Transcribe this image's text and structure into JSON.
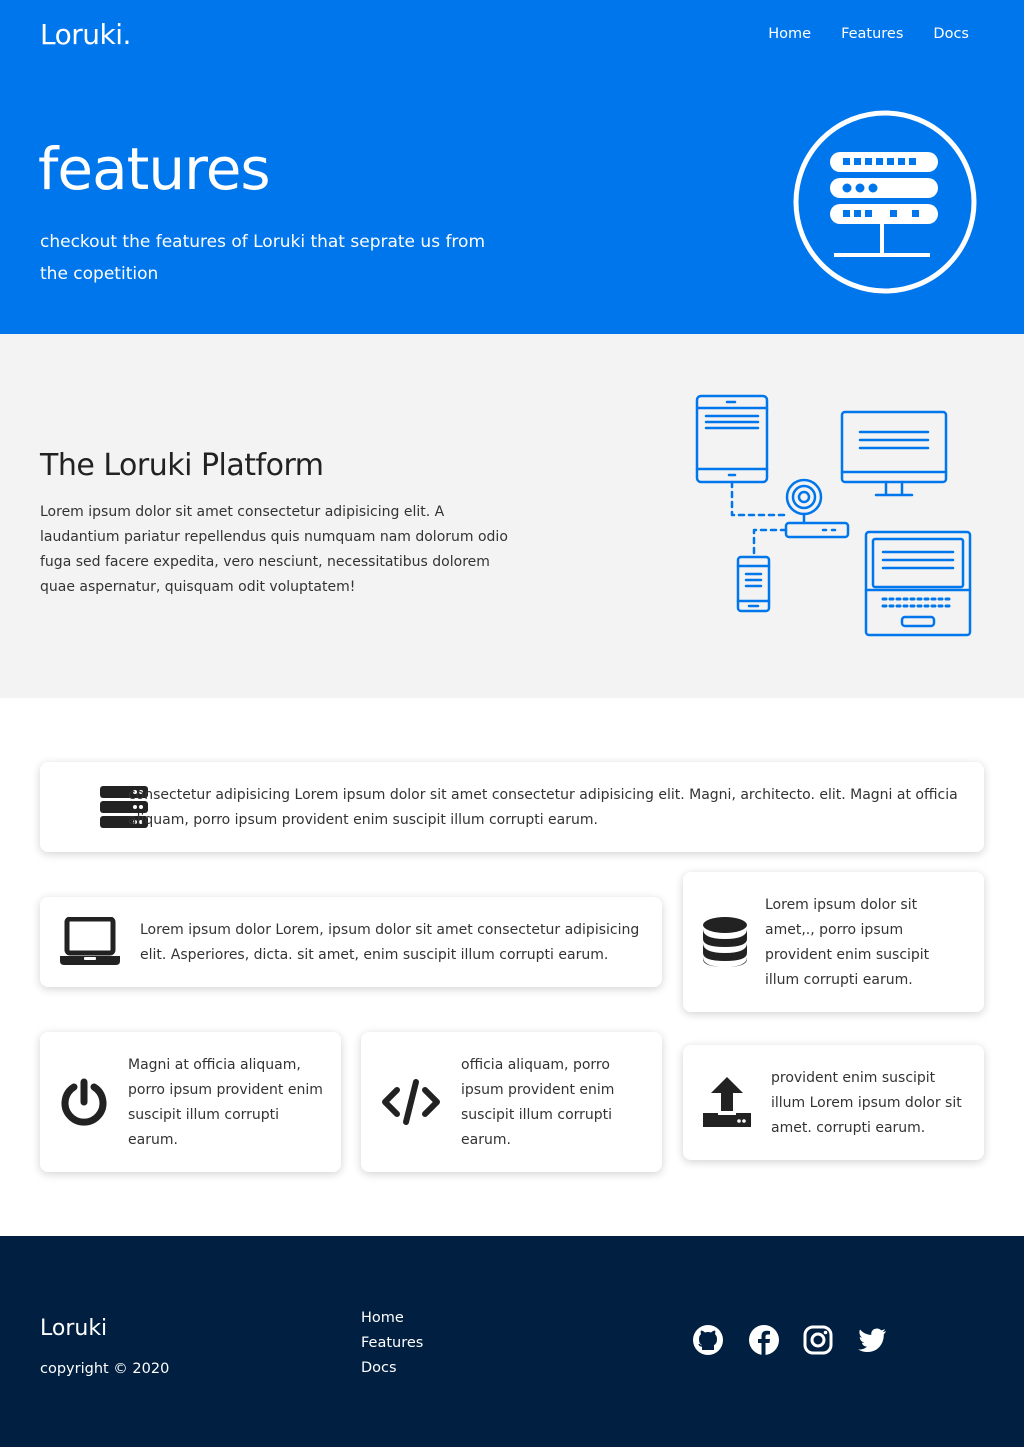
{
  "header": {
    "brand": "Loruki.",
    "nav": [
      "Home",
      "Features",
      "Docs"
    ]
  },
  "hero": {
    "title": "features",
    "subtitle": "checkout the features of Loruki that seprate us from the copetition",
    "icon": "server-circle-icon"
  },
  "platform": {
    "title": "The Loruki Platform",
    "text": "Lorem ipsum dolor sit amet consectetur adipisicing elit. A laudantium pariatur repellendus quis numquam nam dolorum odio fuga sed facere expedita, vero nesciunt, necessitatibus dolorem quae aspernatur, quisquam odit voluptatem!",
    "illustration": "connected-devices-illustration"
  },
  "features": [
    {
      "icon": "server-icon",
      "text": "consectetur adipisicing Lorem ipsum dolor sit amet consectetur adipisicing elit. Magni, architecto. elit. Magni at officia aliquam, porro ipsum provident enim suscipit illum corrupti earum."
    },
    {
      "icon": "laptop-icon",
      "text": "Lorem ipsum dolor Lorem, ipsum dolor sit amet consectetur adipisicing elit. Asperiores, dicta. sit amet, enim suscipit illum corrupti earum."
    },
    {
      "icon": "database-icon",
      "text": "Lorem ipsum dolor sit amet,., porro ipsum provident enim suscipit illum corrupti earum."
    },
    {
      "icon": "power-icon",
      "text": "Magni at officia aliquam, porro ipsum provident enim suscipit illum corrupti earum."
    },
    {
      "icon": "code-icon",
      "text": "officia aliquam, porro ipsum provident enim suscipit illum corrupti earum."
    },
    {
      "icon": "upload-icon",
      "text": "provident enim suscipit illum Lorem ipsum dolor sit amet. corrupti earum."
    }
  ],
  "footer": {
    "brand": "Loruki",
    "copyright": "copyright © 2020",
    "links": [
      "Home",
      "Features",
      "Docs"
    ],
    "social": [
      "github-icon",
      "facebook-icon",
      "instagram-icon",
      "twitter-icon"
    ]
  },
  "colors": {
    "primary": "#0076ec",
    "light_bg": "#f3f3f3",
    "footer_bg": "#001f41",
    "icon_dark": "#222222"
  }
}
